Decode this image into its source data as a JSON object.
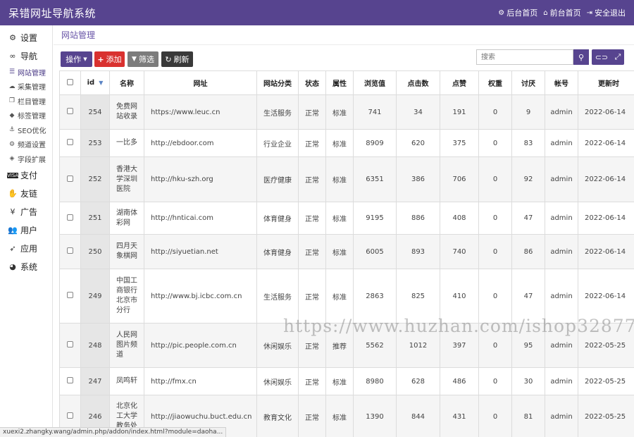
{
  "header": {
    "title": "呆错网址导航系统",
    "links": [
      {
        "label": "后台首页",
        "icon": "gear-icon"
      },
      {
        "label": "前台首页",
        "icon": "home-icon"
      },
      {
        "label": "安全退出",
        "icon": "logout-icon"
      }
    ]
  },
  "sidebar": {
    "settings": "设置",
    "nav": "导航",
    "sub": [
      "网站管理",
      "采集管理",
      "栏目管理",
      "标签管理",
      "SEO优化",
      "频道设置",
      "字段扩展"
    ],
    "pay": "支付",
    "friend_links": "友链",
    "ads": "广告",
    "users": "用户",
    "apps": "应用",
    "system": "系统"
  },
  "breadcrumb": "网站管理",
  "toolbar": {
    "operate_label": "操作",
    "add_label": "添加",
    "filter_label": "筛选",
    "refresh_label": "刷新",
    "search_placeholder": "搜索"
  },
  "table": {
    "columns": [
      "id",
      "名称",
      "网址",
      "网站分类",
      "状态",
      "属性",
      "浏览值",
      "点击数",
      "点赞",
      "权重",
      "讨厌",
      "帐号",
      "更新时"
    ],
    "rows": [
      {
        "id": "254",
        "name": "免费网站收录",
        "url": "https://www.leuc.cn",
        "category": "生活服务",
        "status": "正常",
        "attr": "标准",
        "views": "741",
        "clicks": "34",
        "likes": "191",
        "weight": "0",
        "dislikes": "9",
        "account": "admin",
        "updated": "2022-06-14"
      },
      {
        "id": "253",
        "name": "一比多",
        "url": "http://ebdoor.com",
        "category": "行业企业",
        "status": "正常",
        "attr": "标准",
        "views": "8909",
        "clicks": "620",
        "likes": "375",
        "weight": "0",
        "dislikes": "83",
        "account": "admin",
        "updated": "2022-06-14"
      },
      {
        "id": "252",
        "name": "香港大学深圳医院",
        "url": "http://hku-szh.org",
        "category": "医疗健康",
        "status": "正常",
        "attr": "标准",
        "views": "6351",
        "clicks": "386",
        "likes": "706",
        "weight": "0",
        "dislikes": "92",
        "account": "admin",
        "updated": "2022-06-14"
      },
      {
        "id": "251",
        "name": "湖南体彩网",
        "url": "http://hnticai.com",
        "category": "体育健身",
        "status": "正常",
        "attr": "标准",
        "views": "9195",
        "clicks": "886",
        "likes": "408",
        "weight": "0",
        "dislikes": "47",
        "account": "admin",
        "updated": "2022-06-14"
      },
      {
        "id": "250",
        "name": "四月天象棋网",
        "url": "http://siyuetian.net",
        "category": "体育健身",
        "status": "正常",
        "attr": "标准",
        "views": "6005",
        "clicks": "893",
        "likes": "740",
        "weight": "0",
        "dislikes": "86",
        "account": "admin",
        "updated": "2022-06-14"
      },
      {
        "id": "249",
        "name": "中国工商银行北京市分行",
        "url": "http://www.bj.icbc.com.cn",
        "category": "生活服务",
        "status": "正常",
        "attr": "标准",
        "views": "2863",
        "clicks": "825",
        "likes": "410",
        "weight": "0",
        "dislikes": "47",
        "account": "admin",
        "updated": "2022-06-14"
      },
      {
        "id": "248",
        "name": "人民网图片频道",
        "url": "http://pic.people.com.cn",
        "category": "休闲娱乐",
        "status": "正常",
        "attr": "推荐",
        "views": "5562",
        "clicks": "1012",
        "likes": "397",
        "weight": "0",
        "dislikes": "95",
        "account": "admin",
        "updated": "2022-05-25"
      },
      {
        "id": "247",
        "name": "凤鸣轩",
        "url": "http://fmx.cn",
        "category": "休闲娱乐",
        "status": "正常",
        "attr": "标准",
        "views": "8980",
        "clicks": "628",
        "likes": "486",
        "weight": "0",
        "dislikes": "30",
        "account": "admin",
        "updated": "2022-05-25"
      },
      {
        "id": "246",
        "name": "北京化工大学教务处",
        "url": "http://jiaowuchu.buct.edu.cn",
        "category": "教育文化",
        "status": "正常",
        "attr": "标准",
        "views": "1390",
        "clicks": "844",
        "likes": "431",
        "weight": "0",
        "dislikes": "81",
        "account": "admin",
        "updated": "2022-05-25"
      }
    ]
  },
  "watermark": "https://www.huzhan.com/ishop32877",
  "statusbar": "xuexi2.zhangky.wang/admin.php/addon/index.html?module=daoha..."
}
